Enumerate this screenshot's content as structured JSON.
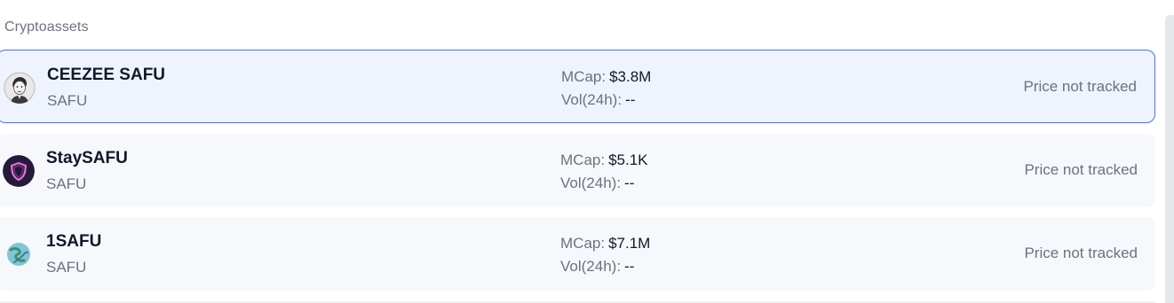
{
  "section": {
    "title": "Cryptoassets"
  },
  "assets": [
    {
      "name": "CEEZEE SAFU",
      "symbol": "SAFU",
      "mcap_label": "MCap:",
      "mcap": "$3.8M",
      "vol_label": "Vol(24h):",
      "vol": "--",
      "price": "Price not tracked",
      "icon": "ceezee-portrait-icon",
      "selected": true
    },
    {
      "name": "StaySAFU",
      "symbol": "SAFU",
      "mcap_label": "MCap:",
      "mcap": "$5.1K",
      "vol_label": "Vol(24h):",
      "vol": "--",
      "price": "Price not tracked",
      "icon": "shield-icon",
      "selected": false
    },
    {
      "name": "1SAFU",
      "symbol": "SAFU",
      "mcap_label": "MCap:",
      "mcap": "$7.1M",
      "vol_label": "Vol(24h):",
      "vol": "--",
      "price": "Price not tracked",
      "icon": "globe-icon",
      "selected": false
    }
  ],
  "colors": {
    "selected_border": "#4f6fe0",
    "selected_bg": "#eef3fe",
    "row_bg": "#f7f8fc",
    "muted_text": "#6b7280",
    "primary_text": "#111827"
  }
}
